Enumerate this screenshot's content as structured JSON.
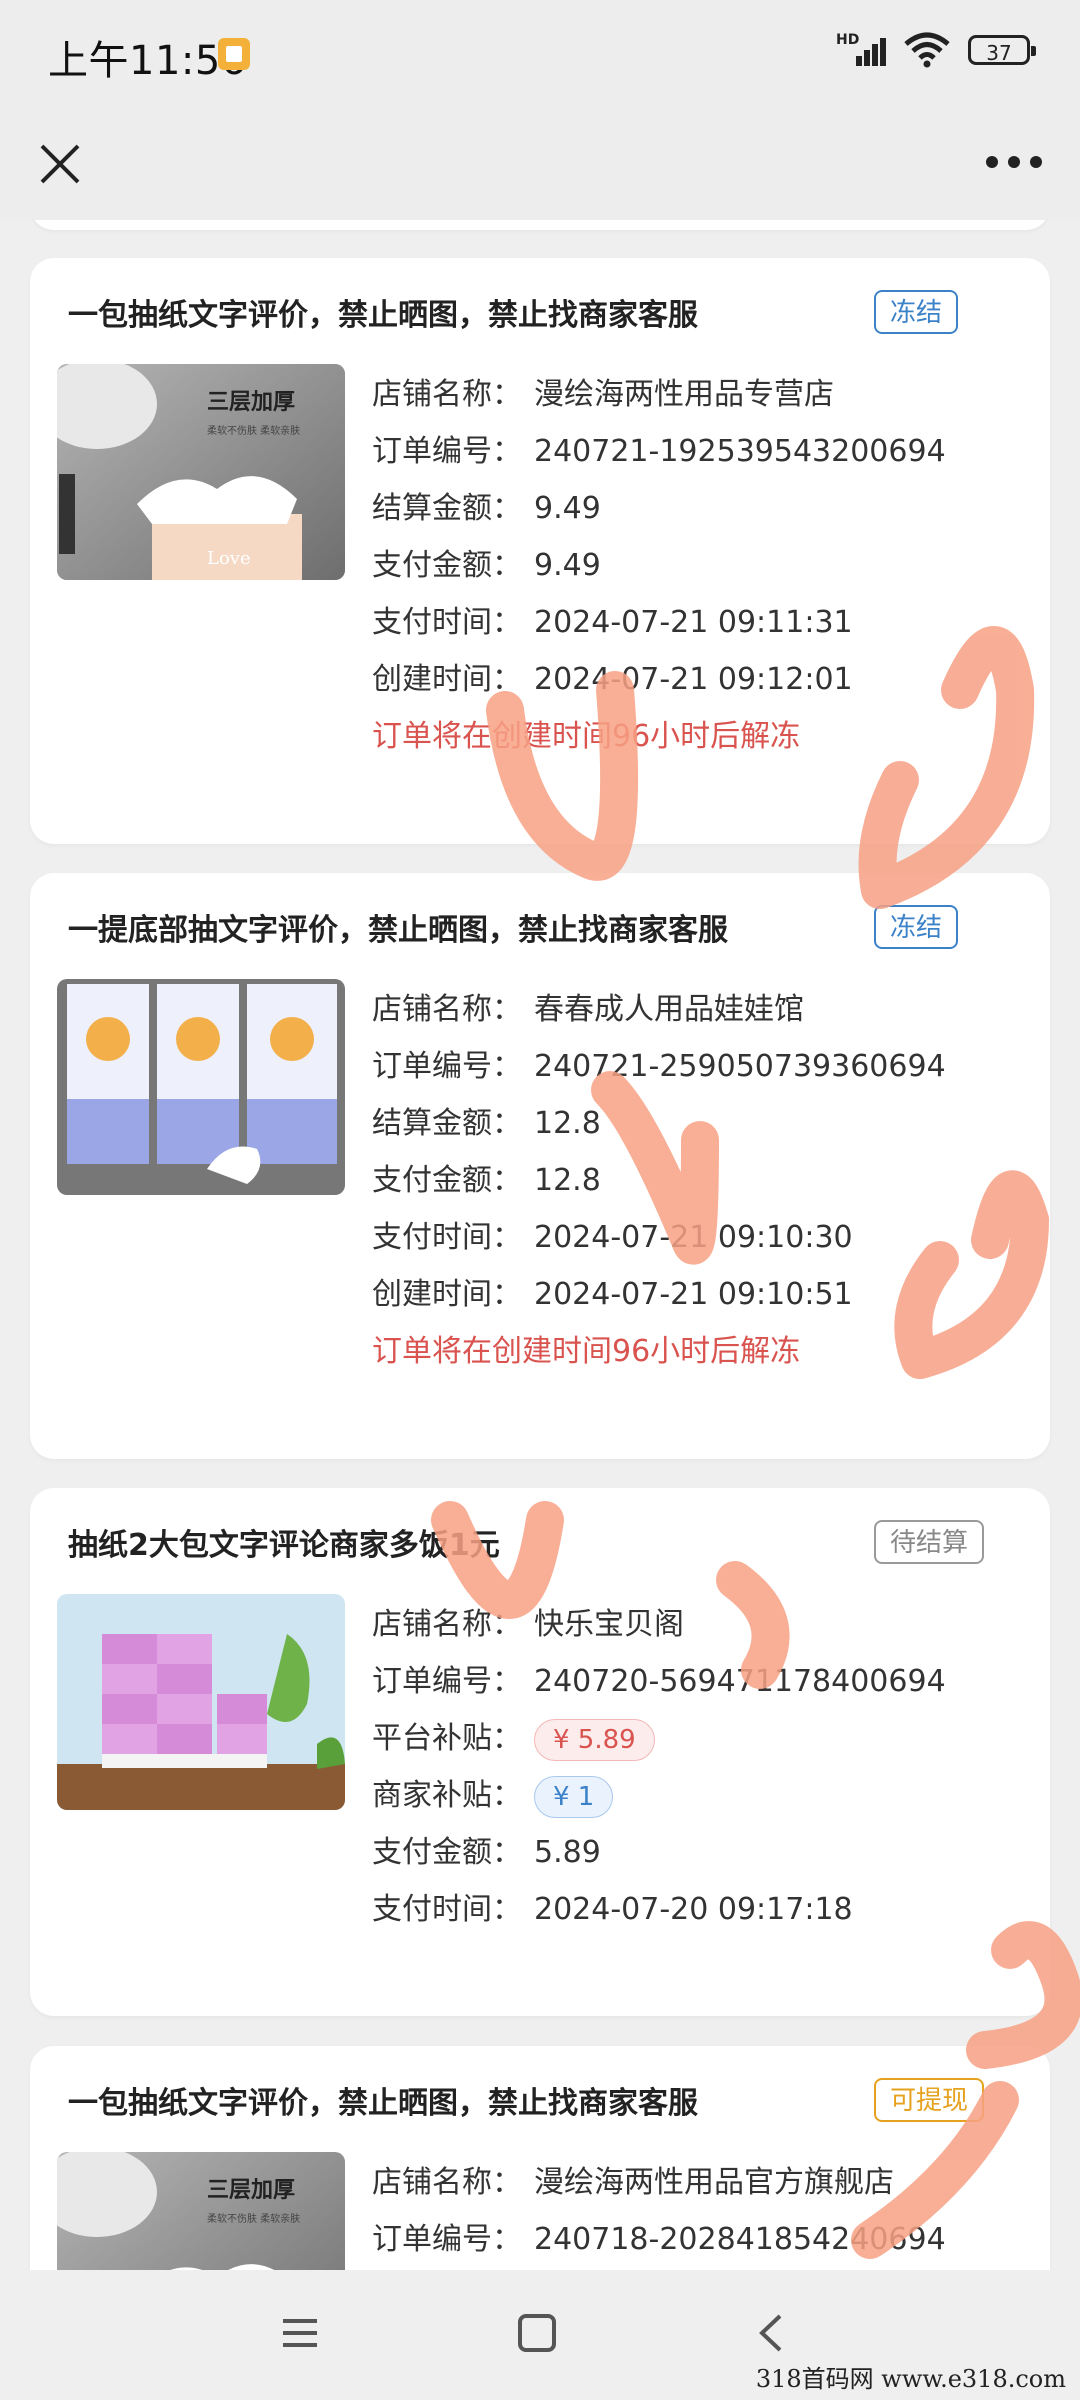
{
  "status_bar": {
    "time": "上午11:56",
    "battery": "37",
    "network": "HD"
  },
  "orders": [
    {
      "title": "一包抽纸文字评价，禁止晒图，禁止找商家客服",
      "status": "冻结",
      "thumb_text": "三层加厚",
      "thumb_sub": "Love",
      "rows": [
        {
          "label": "店铺名称：",
          "value": "漫绘海两性用品专营店"
        },
        {
          "label": "订单编号：",
          "value": "240721-192539543200694"
        },
        {
          "label": "结算金额：",
          "value": "9.49"
        },
        {
          "label": "支付金额：",
          "value": "9.49"
        },
        {
          "label": "支付时间：",
          "value": "2024-07-21 09:11:31"
        },
        {
          "label": "创建时间：",
          "value": "2024-07-21 09:12:01"
        }
      ],
      "notice": "订单将在创建时间96小时后解冻"
    },
    {
      "title": "一提底部抽文字评价，禁止晒图，禁止找商家客服",
      "status": "冻结",
      "rows": [
        {
          "label": "店铺名称：",
          "value": "春春成人用品娃娃馆"
        },
        {
          "label": "订单编号：",
          "value": "240721-259050739360694"
        },
        {
          "label": "结算金额：",
          "value": "12.8"
        },
        {
          "label": "支付金额：",
          "value": "12.8"
        },
        {
          "label": "支付时间：",
          "value": "2024-07-21 09:10:30"
        },
        {
          "label": "创建时间：",
          "value": "2024-07-21 09:10:51"
        }
      ],
      "notice": "订单将在创建时间96小时后解冻"
    },
    {
      "title": "抽纸2大包文字评论商家多饭1元",
      "status": "待结算",
      "rows": [
        {
          "label": "店铺名称：",
          "value": "快乐宝贝阁"
        },
        {
          "label": "订单编号：",
          "value": "240720-569471178400694"
        },
        {
          "label": "平台补贴：",
          "value": "¥ 5.89"
        },
        {
          "label": "商家补贴：",
          "value": "¥ 1"
        },
        {
          "label": "支付金额：",
          "value": "5.89"
        },
        {
          "label": "支付时间：",
          "value": "2024-07-20 09:17:18"
        }
      ]
    },
    {
      "title": "一包抽纸文字评价，禁止晒图，禁止找商家客服",
      "status": "可提现",
      "thumb_text": "三层加厚",
      "rows": [
        {
          "label": "店铺名称：",
          "value": "漫绘海两性用品官方旗舰店"
        },
        {
          "label": "订单编号：",
          "value": "240718-202841854240694"
        }
      ]
    }
  ],
  "watermark": "318首码网  www.e318.com",
  "colors": {
    "frozen": "#3c82c8",
    "pending": "#888888",
    "withdraw": "#e6a21e",
    "warn": "#d9534f",
    "scribble": "#f7a184"
  },
  "icons": [
    "close-icon",
    "more-icon",
    "menu-icon",
    "home-icon",
    "back-icon"
  ]
}
